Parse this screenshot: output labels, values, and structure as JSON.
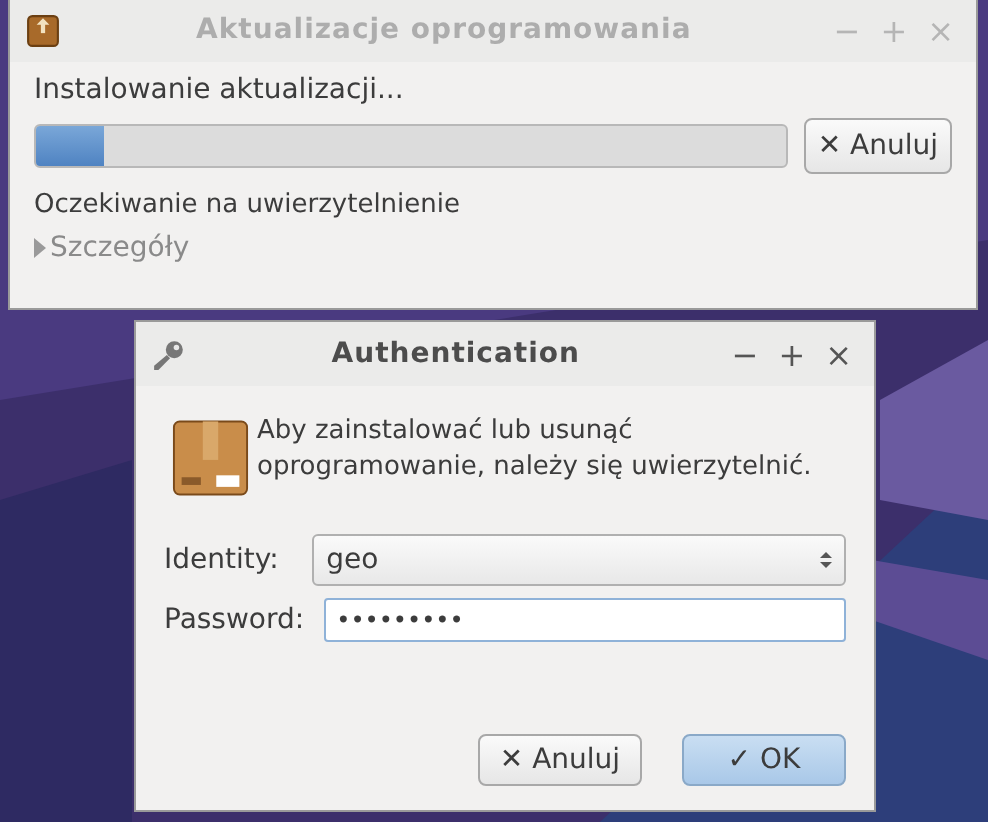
{
  "update_window": {
    "title": "Aktualizacje oprogramowania",
    "active": false,
    "controls": [
      "−",
      "+",
      "×"
    ],
    "heading": "Instalowanie aktualizacji...",
    "progress": {
      "level": 0.09
    },
    "cancel_button": {
      "icon": "✕",
      "label": "Anuluj"
    },
    "status": "Oczekiwanie na uwierzytelnienie",
    "details": {
      "label": "Szczegóły",
      "expanded": false
    }
  },
  "auth_dialog": {
    "title": "Authentication",
    "active": true,
    "controls": [
      "−",
      "+",
      "×"
    ],
    "message": "Aby zainstalować lub usunąć oprogramowanie, należy się uwierzytelnić.",
    "identity": {
      "label": "Identity:",
      "value": "geo"
    },
    "password": {
      "label": "Password:",
      "value": "•••••••••"
    },
    "buttons": [
      {
        "icon": "✕",
        "label": "Anuluj",
        "default": false
      },
      {
        "icon": "✓",
        "label": "OK",
        "default": true
      }
    ]
  }
}
